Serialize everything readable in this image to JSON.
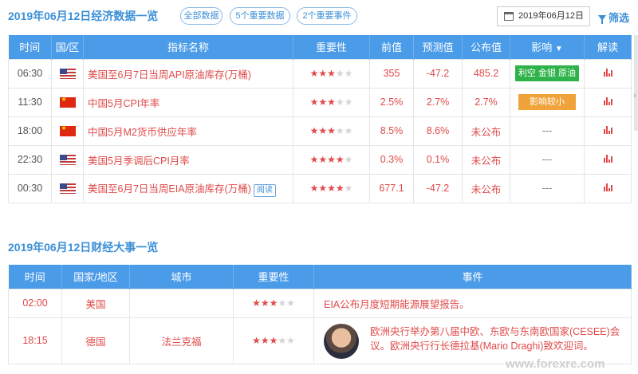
{
  "header": {
    "title": "2019年06月12日经济数据一览",
    "filters": [
      "全部数据",
      "5个重要数据",
      "2个重要事件"
    ],
    "date": "2019年06月12日",
    "filter_label": "筛选"
  },
  "data_table": {
    "columns": [
      "时间",
      "国/区",
      "指标名称",
      "重要性",
      "前值",
      "预测值",
      "公布值",
      "影响",
      "解读"
    ],
    "rows": [
      {
        "time": "06:30",
        "flag": "us-flag-icon",
        "name": "美国至6月7日当周API原油库存(万桶)",
        "stars": 3,
        "prev": "355",
        "forecast": "-47.2",
        "actual": "485.2",
        "impact": "利空 金银 原油",
        "impact_color": "#2eb34a",
        "read": ""
      },
      {
        "time": "11:30",
        "flag": "cn-flag-icon",
        "name": "中国5月CPI年率",
        "stars": 3,
        "prev": "2.5%",
        "forecast": "2.7%",
        "actual": "2.7%",
        "impact": "影响较小",
        "impact_color": "#f0a33a",
        "read": ""
      },
      {
        "time": "18:00",
        "flag": "cn-flag-icon",
        "name": "中国5月M2货币供应年率",
        "stars": 3,
        "prev": "8.5%",
        "forecast": "8.6%",
        "actual": "未公布",
        "impact": "---",
        "impact_color": "",
        "read": ""
      },
      {
        "time": "22:30",
        "flag": "us-flag-icon",
        "name": "美国5月季调后CPI月率",
        "stars": 4,
        "prev": "0.3%",
        "forecast": "0.1%",
        "actual": "未公布",
        "impact": "---",
        "impact_color": "",
        "read": ""
      },
      {
        "time": "00:30",
        "flag": "us-flag-icon",
        "name": "美国至6月7日当周EIA原油库存(万桶)",
        "stars": 4,
        "prev": "677.1",
        "forecast": "-47.2",
        "actual": "未公布",
        "impact": "---",
        "impact_color": "",
        "read": "阅读"
      }
    ]
  },
  "events_section": {
    "title": "2019年06月12日财经大事一览",
    "columns": [
      "时间",
      "国家/地区",
      "城市",
      "重要性",
      "事件"
    ],
    "rows": [
      {
        "time": "02:00",
        "country": "美国",
        "city": "",
        "stars": 3,
        "event": "EIA公布月度短期能源展望报告。"
      },
      {
        "time": "18:15",
        "country": "德国",
        "city": "法兰克福",
        "stars": 3,
        "event": "欧洲央行举办第八届中欧、东欧与东南欧国家(CESEE)会议。欧洲央行行长德拉基(Mario Draghi)致欢迎词。"
      }
    ]
  },
  "watermark": "www.forexre.com"
}
